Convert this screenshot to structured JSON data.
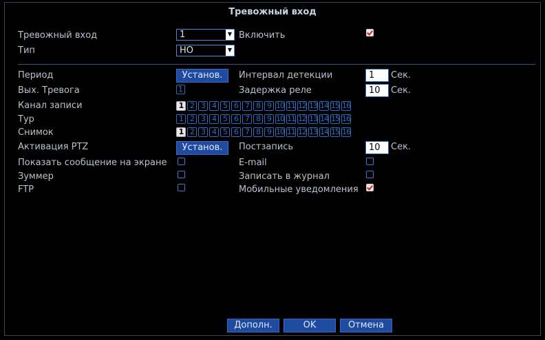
{
  "dialog": {
    "title": "Тревожный вход"
  },
  "alarm_input": {
    "label": "Тревожный вход",
    "value": "1"
  },
  "enable": {
    "label": "Включить",
    "checked": true
  },
  "type": {
    "label": "Тип",
    "value": "НО"
  },
  "period": {
    "label": "Период",
    "button": "Установ."
  },
  "detect_interval": {
    "label": "Интервал детекции",
    "value": "1",
    "unit": "Сек."
  },
  "alarm_out": {
    "label": "Вых. Тревога",
    "value": "1"
  },
  "relay_delay": {
    "label": "Задержка реле",
    "value": "10",
    "unit": "Сек."
  },
  "record_channel": {
    "label": "Канал записи",
    "channels": [
      "1",
      "2",
      "3",
      "4",
      "5",
      "6",
      "7",
      "8",
      "9",
      "10",
      "11",
      "12",
      "13",
      "14",
      "15",
      "16"
    ],
    "selected": [
      1
    ]
  },
  "tour": {
    "label": "Тур",
    "channels": [
      "1",
      "2",
      "3",
      "4",
      "5",
      "6",
      "7",
      "8",
      "9",
      "10",
      "11",
      "12",
      "13",
      "14",
      "15",
      "16"
    ],
    "selected": []
  },
  "snapshot": {
    "label": "Снимок",
    "channels": [
      "1",
      "2",
      "3",
      "4",
      "5",
      "6",
      "7",
      "8",
      "9",
      "10",
      "11",
      "12",
      "13",
      "14",
      "15",
      "16"
    ],
    "selected": [
      1
    ]
  },
  "ptz": {
    "label": "Активация PTZ",
    "button": "Установ."
  },
  "post_record": {
    "label": "Постзапись",
    "value": "10",
    "unit": "Сек."
  },
  "show_message": {
    "label": "Показать сообщение на экране",
    "checked": false
  },
  "email": {
    "label": "E-mail",
    "checked": false
  },
  "buzzer": {
    "label": "Зуммер",
    "checked": false
  },
  "write_log": {
    "label": "Записать в журнал",
    "checked": false
  },
  "ftp": {
    "label": "FTP",
    "checked": false
  },
  "mobile": {
    "label": "Мобильные уведомления",
    "checked": true
  },
  "footer": {
    "advanced": "Дополн.",
    "ok": "OK",
    "cancel": "Отмена"
  }
}
